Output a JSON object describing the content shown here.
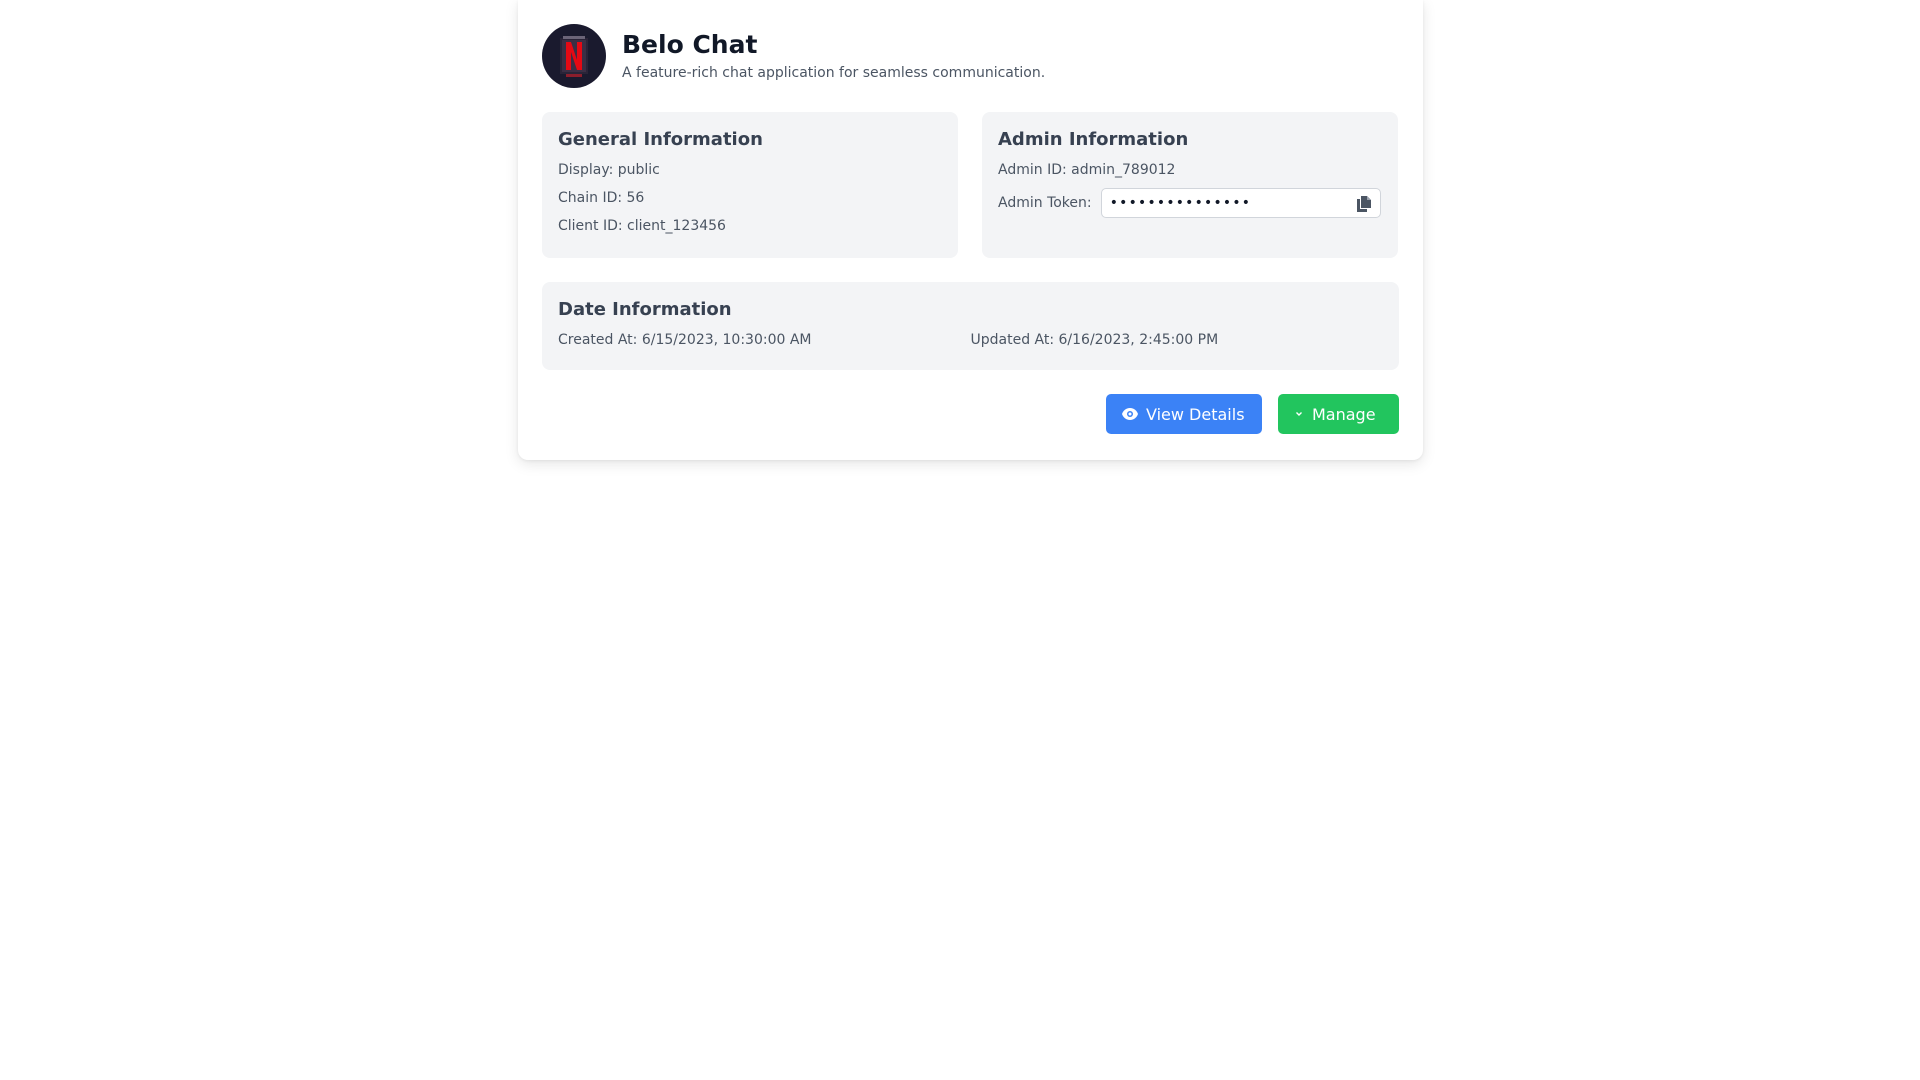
{
  "app": {
    "title": "Belo Chat",
    "description": "A feature-rich chat application for seamless communication.",
    "logo_icon": "netflix-n-logo",
    "logo_bg_color": "#1a1a2e",
    "logo_accent_color": "#e50914"
  },
  "general": {
    "title": "General Information",
    "display": "Display: public",
    "chain_id": "Chain ID: 56",
    "client_id": "Client ID: client_123456"
  },
  "admin": {
    "title": "Admin Information",
    "admin_id": "Admin ID: admin_789012",
    "token_label": "Admin Token:",
    "token_value": "•••••••••••••••",
    "copy_icon": "copy-icon"
  },
  "dates": {
    "title": "Date Information",
    "created": "Created At: 6/15/2023, 10:30:00 AM",
    "updated": "Updated At: 6/16/2023, 2:45:00 PM"
  },
  "actions": {
    "view_details": {
      "label": "View Details",
      "icon": "eye-icon",
      "color": "#3b82f6"
    },
    "manage": {
      "label": "Manage",
      "icon": "chevron-down-icon",
      "color": "#22c55e"
    }
  }
}
